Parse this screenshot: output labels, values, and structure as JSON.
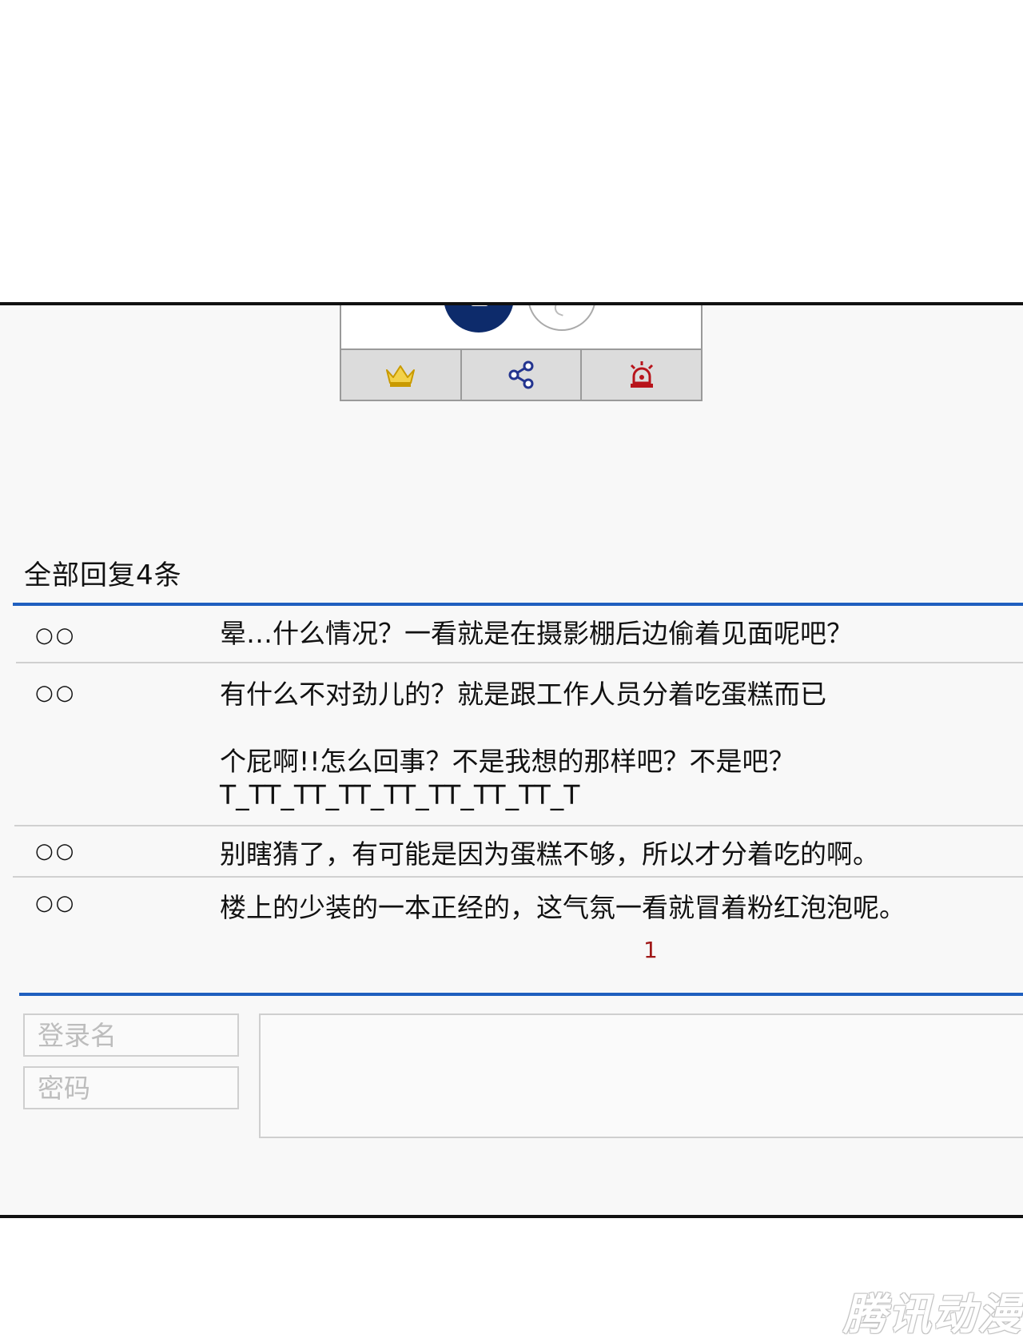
{
  "actions": {
    "vip_icon_color": "#e8b800",
    "share_icon_color": "#23348f",
    "report_icon_color": "#b8141b"
  },
  "replies": {
    "header": "全部回复4条",
    "items": [
      {
        "user": "○○",
        "text": "晕…什么情况？一看就是在摄影棚后边偷着见面呢吧？"
      },
      {
        "user": "○○",
        "text": "有什么不对劲儿的？就是跟工作人员分着吃蛋糕而已\n\n个屁啊!!怎么回事？不是我想的那样吧？不是吧？\nT_TT_TT_TT_TT_TT_TT_TT_T"
      },
      {
        "user": "○○",
        "text": "别瞎猜了，有可能是因为蛋糕不够，所以才分着吃的啊。"
      },
      {
        "user": "○○",
        "text": "楼上的少装的一本正经的，这气氛一看就冒着粉红泡泡呢。"
      }
    ],
    "page": "1"
  },
  "login": {
    "username_placeholder": "登录名",
    "password_placeholder": "密码"
  },
  "colors": {
    "accent_blue": "#1f5fbf",
    "pager_red": "#a01818"
  },
  "watermark": "腾讯动漫"
}
